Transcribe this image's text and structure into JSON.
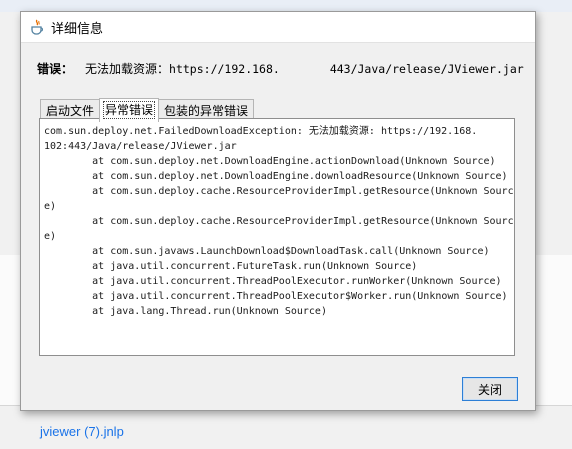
{
  "background": {
    "link_text": "jviewer (7).jnlp",
    "link_color": "#1a73e8"
  },
  "dialog": {
    "title": "详细信息",
    "title_icon": "java-icon",
    "error_label": "错误：",
    "error_message": "无法加载资源：",
    "error_url_start": "https://192.168.",
    "error_url_end": "443/Java/release/JViewer.jar",
    "tabs": [
      {
        "label": "启动文件",
        "active": false
      },
      {
        "label": "异常错误",
        "active": true
      },
      {
        "label": "包装的异常错误",
        "active": false
      }
    ],
    "stack_lines": [
      "com.sun.deploy.net.FailedDownloadException: 无法加载资源: https://192.168.",
      "102:443/Java/release/JViewer.jar",
      "        at com.sun.deploy.net.DownloadEngine.actionDownload(Unknown Source)",
      "        at com.sun.deploy.net.DownloadEngine.downloadResource(Unknown Source)",
      "        at com.sun.deploy.cache.ResourceProviderImpl.getResource(Unknown Sourc",
      "e)",
      "        at com.sun.deploy.cache.ResourceProviderImpl.getResource(Unknown Sourc",
      "e)",
      "        at com.sun.javaws.LaunchDownload$DownloadTask.call(Unknown Source)",
      "        at java.util.concurrent.FutureTask.run(Unknown Source)",
      "        at java.util.concurrent.ThreadPoolExecutor.runWorker(Unknown Source)",
      "        at java.util.concurrent.ThreadPoolExecutor$Worker.run(Unknown Source)",
      "        at java.lang.Thread.run(Unknown Source)"
    ],
    "close_label": "关闭"
  }
}
